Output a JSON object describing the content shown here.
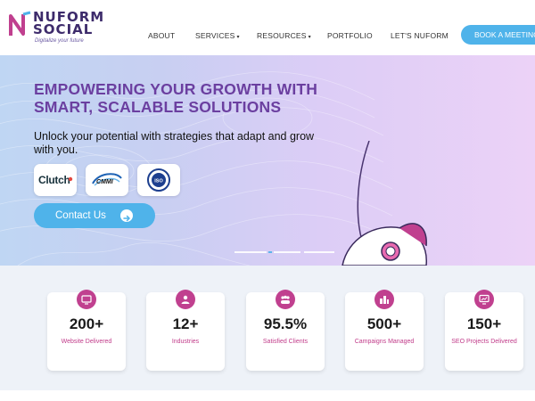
{
  "logo": {
    "line1": "NUFORM",
    "line2": "SOCIAL",
    "tagline": "Digitalize your future"
  },
  "nav": {
    "items": [
      {
        "label": "ABOUT",
        "dropdown": false
      },
      {
        "label": "SERVICES",
        "dropdown": true
      },
      {
        "label": "RESOURCES",
        "dropdown": true
      },
      {
        "label": "PORTFOLIO",
        "dropdown": false
      },
      {
        "label": "LET'S NUFORM",
        "dropdown": false
      }
    ],
    "cta_label": "BOOK A MEETING"
  },
  "hero": {
    "title": "EMPOWERING YOUR GROWTH WITH SMART, SCALABLE SOLUTIONS",
    "subtitle": "Unlock your potential with strategies that adapt and grow with you.",
    "badges": [
      {
        "name": "clutch",
        "text": "Clutch"
      },
      {
        "name": "cmmi",
        "text": "CMMI"
      },
      {
        "name": "iso",
        "text": "ISO"
      }
    ],
    "contact_label": "Contact Us",
    "slider": {
      "count": 3,
      "active": 1
    }
  },
  "stats": [
    {
      "icon": "website-icon",
      "value": "200+",
      "label": "Website Delivered"
    },
    {
      "icon": "industries-icon",
      "value": "12+",
      "label": "Industries"
    },
    {
      "icon": "clients-icon",
      "value": "95.5%",
      "label": "Satisfied Clients"
    },
    {
      "icon": "campaign-icon",
      "value": "500+",
      "label": "Campaigns Managed"
    },
    {
      "icon": "seo-icon",
      "value": "150+",
      "label": "SEO Projects Delivered"
    }
  ],
  "colors": {
    "brand_purple": "#6b3fa0",
    "accent_blue": "#4fb3ea",
    "stat_pink": "#c0408f"
  }
}
